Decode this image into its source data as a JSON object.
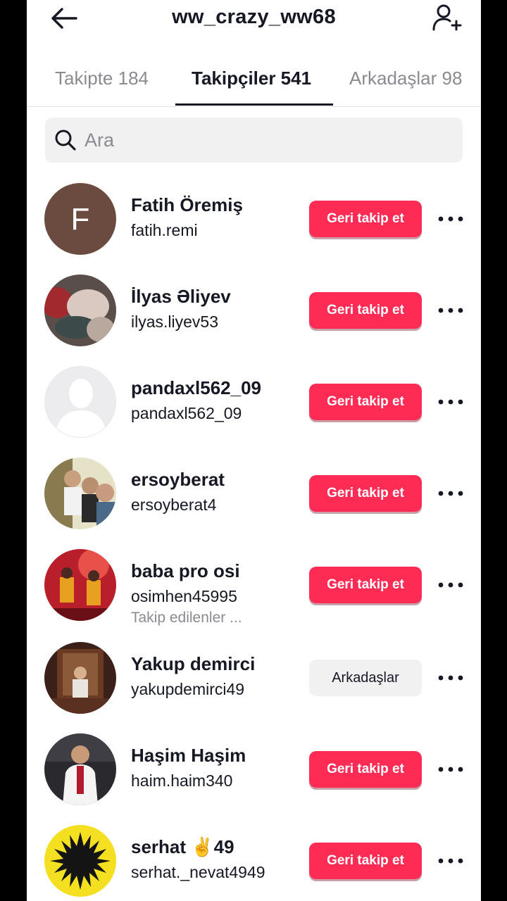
{
  "header": {
    "title": "ww_crazy_ww68",
    "back_icon": "arrow-left-icon",
    "add_icon": "add-user-icon"
  },
  "tabs": [
    {
      "label": "Takipte 184",
      "active": false
    },
    {
      "label": "Takipçiler 541",
      "active": true
    },
    {
      "label": "Arkadaşlar 98",
      "active": false
    }
  ],
  "search": {
    "placeholder": "Ara",
    "value": ""
  },
  "colors": {
    "accent": "#fe2c55",
    "text": "#161823",
    "muted": "#8a8b91",
    "chip": "#f1f1f2"
  },
  "users": [
    {
      "name": "Fatih Öremiş",
      "handle": "fatih.remi",
      "sub": "",
      "button": "Geri takip et",
      "initial": "F"
    },
    {
      "name": "İlyas Əliyev",
      "handle": "ilyas.liyev53",
      "sub": "",
      "button": "Geri takip et"
    },
    {
      "name": "pandaxl562_09",
      "handle": "pandaxl562_09",
      "sub": "",
      "button": "Geri takip et"
    },
    {
      "name": "ersoyberat",
      "handle": "ersoyberat4",
      "sub": "",
      "button": "Geri takip et"
    },
    {
      "name": "baba pro osi",
      "handle": "osimhen45995",
      "sub": "Takip edilenler ...",
      "button": "Geri takip et"
    },
    {
      "name": "Yakup demirci",
      "handle": "yakupdemirci49",
      "sub": "",
      "button": "Arkadaşlar"
    },
    {
      "name": "Haşim Haşim",
      "handle": "haim.haim340",
      "sub": "",
      "button": "Geri takip et"
    },
    {
      "name": "serhat ✌️49",
      "handle": "serhat._nevat4949",
      "sub": "",
      "button": "Geri takip et"
    }
  ]
}
